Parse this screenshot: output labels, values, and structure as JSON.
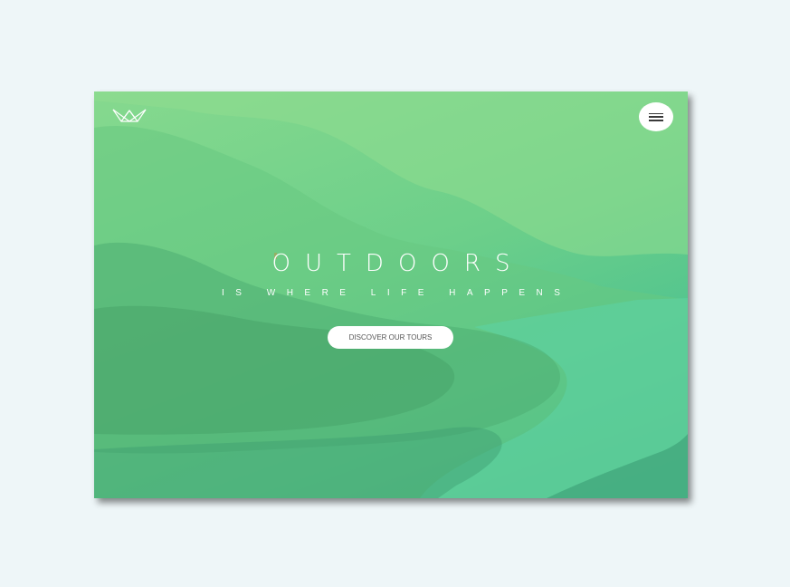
{
  "hero": {
    "title": "OUTDOORS",
    "subtitle": "IS WHERE LIFE HAPPENS",
    "cta_label": "DISCOVER OUR TOURS"
  },
  "header": {
    "logo_icon": "crown-outline-icon",
    "menu_icon": "hamburger-menu-icon"
  },
  "colors": {
    "page_background": "#eef6f8",
    "overlay_top": "#86d98e",
    "overlay_bottom": "#3eb18a",
    "button_background": "#ffffff",
    "text": "#ffffff"
  }
}
